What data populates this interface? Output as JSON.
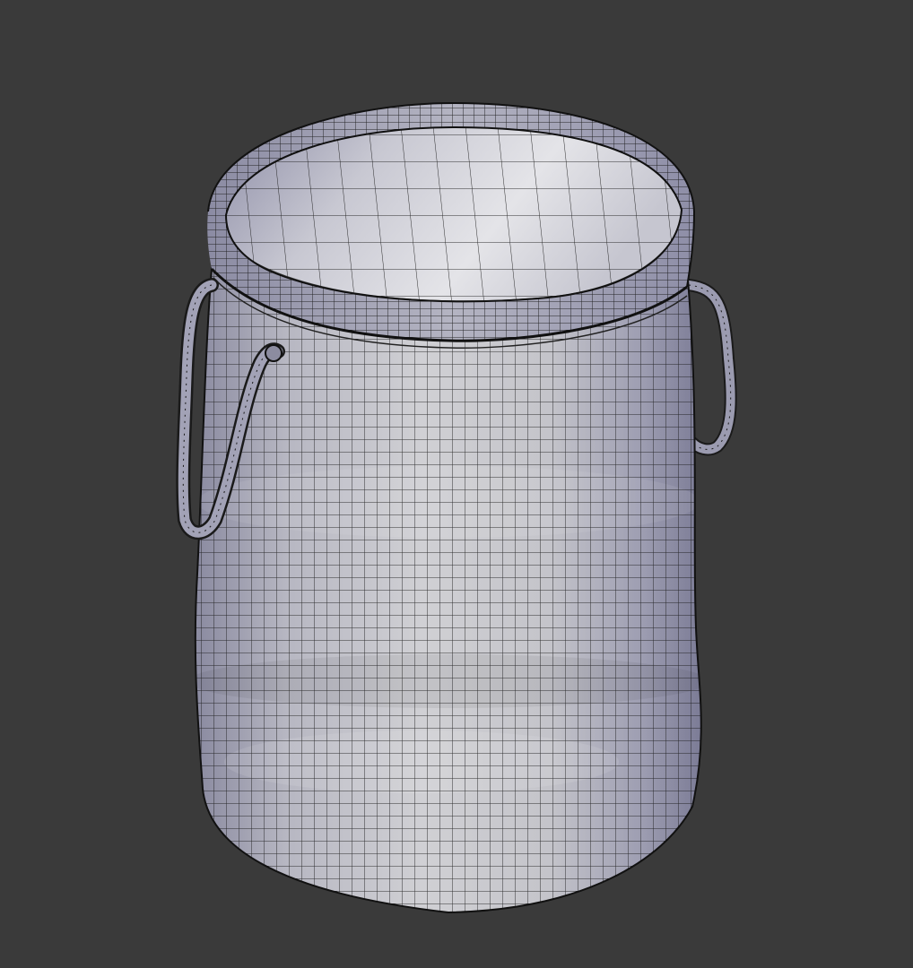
{
  "viewport": {
    "background_color": "#3a3a3a",
    "shading_mode": "solid-with-wireframe",
    "object": {
      "kind": "fabric-basket",
      "has_rope_handles": true,
      "handle_count": 2,
      "colors": {
        "surface_light": "#d9d9de",
        "surface_mid": "#a8a8b4",
        "surface_shadow": "#7a7a8e",
        "interior": "#e6e6ea",
        "wire": "#161616"
      }
    }
  }
}
